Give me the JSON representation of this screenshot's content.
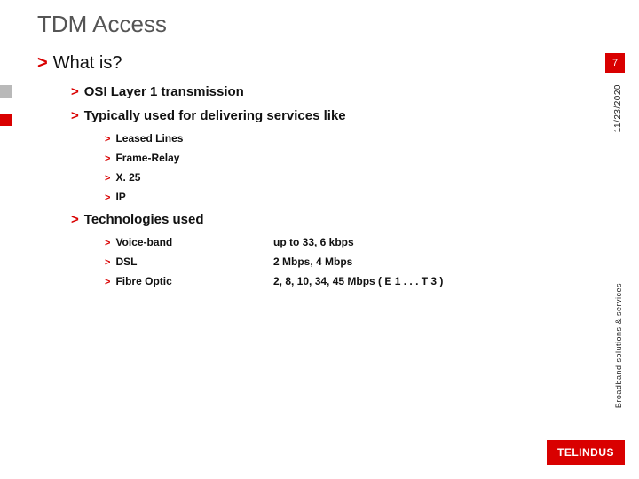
{
  "slide": {
    "title": "TDM Access",
    "page_number": "7",
    "date": "11/23/2020",
    "side_caption": "Broadband solutions & services",
    "logo_text": "TELiNDUS"
  },
  "content": {
    "q": "What is?",
    "p1": "OSI Layer 1 transmission",
    "p2": "Typically used for delivering services like",
    "services": {
      "s1": "Leased Lines",
      "s2": "Frame-Relay",
      "s3": "X. 25",
      "s4": "IP"
    },
    "tech_heading": "Technologies used",
    "tech": {
      "t1name": "Voice-band",
      "t1val": "up to 33, 6 kbps",
      "t2name": "DSL",
      "t2val": "2 Mbps, 4 Mbps",
      "t3name": "Fibre Optic",
      "t3val": "2, 8, 10, 34, 45 Mbps ( E 1 . . . T 3 )"
    }
  }
}
